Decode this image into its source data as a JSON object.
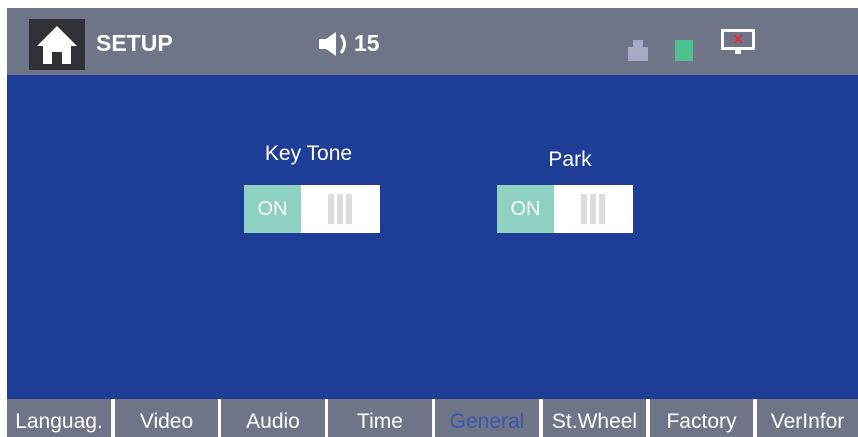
{
  "header": {
    "title": "SETUP",
    "volume": "15",
    "icons": [
      "home-icon",
      "speaker-icon",
      "usb-icon",
      "sd-card-icon",
      "screen-icon"
    ]
  },
  "settings": [
    {
      "label": "Key Tone",
      "state": "ON"
    },
    {
      "label": "Park",
      "state": "ON"
    }
  ],
  "tabs": [
    "Languag.",
    "Video",
    "Audio",
    "Time",
    "General",
    "St.Wheel",
    "Factory",
    "VerInfor"
  ],
  "active_tab": "General",
  "colors": {
    "header_bg": "#6f7487",
    "main_bg": "#1e3d97",
    "toggle_on": "#8ed1c2",
    "sd_icon": "#4fc08f",
    "active_tab_text": "#3a56b0"
  }
}
